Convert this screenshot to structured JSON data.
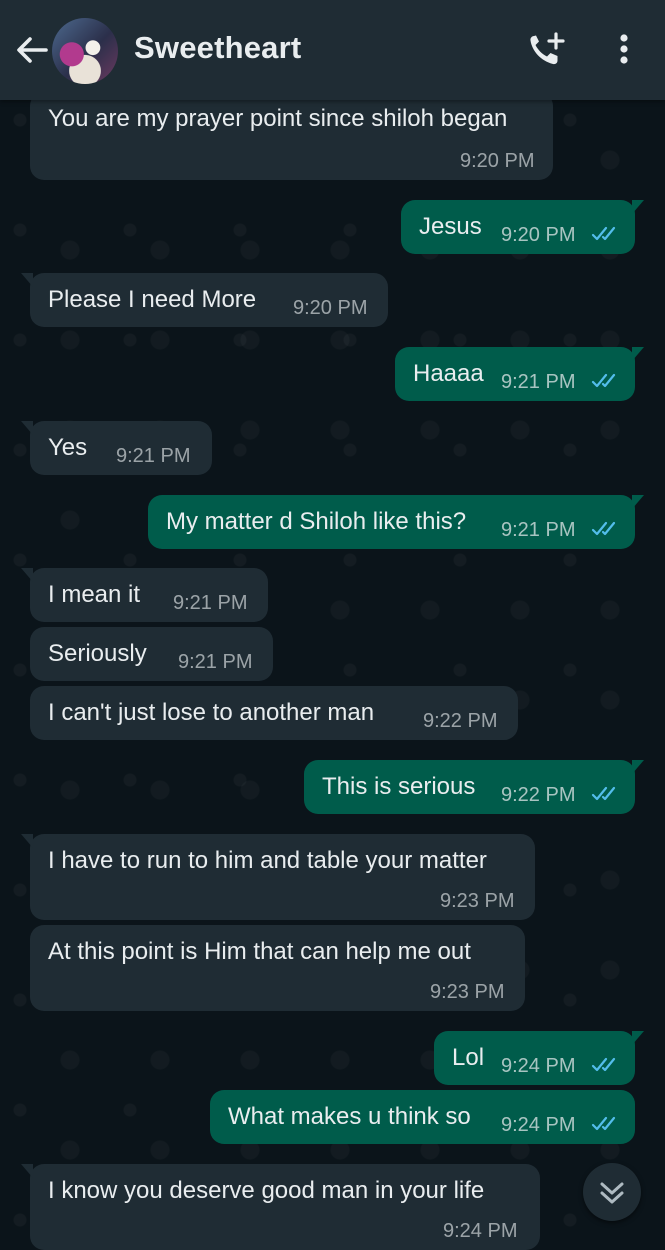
{
  "header": {
    "contact_name": "Sweetheart",
    "back_icon": "arrow-left-icon",
    "call_icon": "add-call-icon",
    "menu_icon": "more-vertical-icon"
  },
  "colors": {
    "header_bg": "#1f2c34",
    "chat_bg": "#0b141a",
    "incoming_bubble": "#1f2c34",
    "outgoing_bubble": "#005c4b",
    "read_ticks": "#53bdeb"
  },
  "messages": [
    {
      "direction": "in",
      "text": "You are my prayer point since shiloh began",
      "time": "9:20 PM"
    },
    {
      "direction": "out",
      "text": "Jesus",
      "time": "9:20 PM",
      "status": "read"
    },
    {
      "direction": "in",
      "text": "Please I need More",
      "time": "9:20 PM"
    },
    {
      "direction": "out",
      "text": "Haaaa",
      "time": "9:21 PM",
      "status": "read"
    },
    {
      "direction": "in",
      "text": "Yes",
      "time": "9:21 PM"
    },
    {
      "direction": "out",
      "text": "My matter d Shiloh like this?",
      "time": "9:21 PM",
      "status": "read"
    },
    {
      "direction": "in",
      "text": "I mean it",
      "time": "9:21 PM"
    },
    {
      "direction": "in",
      "text": "Seriously",
      "time": "9:21 PM"
    },
    {
      "direction": "in",
      "text": "I can't just lose to another man",
      "time": "9:22 PM"
    },
    {
      "direction": "out",
      "text": "This is serious",
      "time": "9:22 PM",
      "status": "read"
    },
    {
      "direction": "in",
      "text": "I have to run to him and table your matter",
      "time": "9:23 PM"
    },
    {
      "direction": "in",
      "text": "At this point is Him that can help me out",
      "time": "9:23 PM"
    },
    {
      "direction": "out",
      "text": "Lol",
      "time": "9:24 PM",
      "status": "read"
    },
    {
      "direction": "out",
      "text": "What makes u think so",
      "time": "9:24 PM",
      "status": "read"
    },
    {
      "direction": "in",
      "text": "I know you deserve  good man in your life",
      "time": "9:24 PM"
    }
  ],
  "scroll_button_icon": "double-chevron-down-icon"
}
